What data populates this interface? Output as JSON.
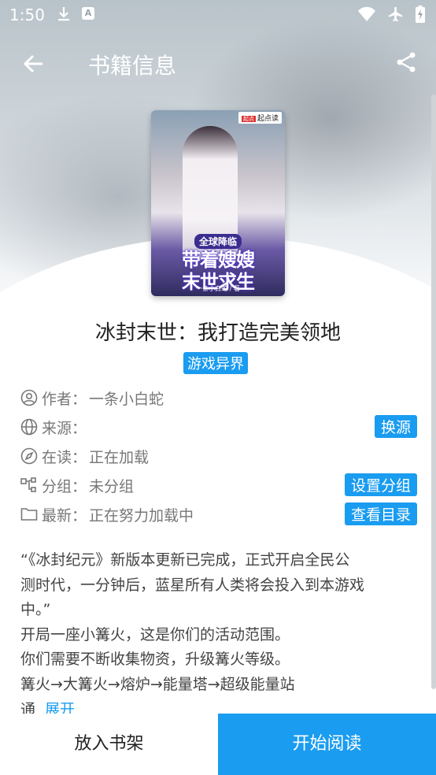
{
  "status_bar": {
    "time": "1:50",
    "icons": [
      "download-icon",
      "a-notification-icon",
      "wifi-icon",
      "airplane-icon",
      "battery-charging-icon"
    ]
  },
  "app_bar": {
    "title": "书籍信息",
    "back_icon": "arrow-left-icon",
    "share_icon": "share-icon"
  },
  "cover": {
    "badge_brand": "起点读",
    "badge_mark": "起点",
    "banner_top": "全球降临",
    "banner_line1": "带着嫂嫂",
    "banner_line2": "末世求生",
    "author_line": "一条小白蛇 / 著"
  },
  "book": {
    "title": "冰封末世：我打造完美领地",
    "tag": "游戏异界"
  },
  "info": {
    "author": {
      "key": "作者：",
      "value": "一条小白蛇"
    },
    "source": {
      "key": "来源：",
      "value": "",
      "button": "换源"
    },
    "reading": {
      "key": "在读：",
      "value": "正在加载"
    },
    "group": {
      "key": "分组：",
      "value": "未分组",
      "button": "设置分组"
    },
    "latest": {
      "key": "最新：",
      "value": "正在努力加载中",
      "button": "查看目录"
    }
  },
  "intro": {
    "line1": "“《冰封纪元》新版本更新已完成，正式开启全民公",
    "line2": "测时代，一分钟后，蓝星所有人类将会投入到本游戏",
    "line3": "中。”",
    "line4": "开局一座小篝火，这是你们的活动范围。",
    "line5": "你们需要不断收集物资，升级篝火等级。",
    "line6": "篝火→大篝火→熔炉→能量塔→超级能量站",
    "line7": "通",
    "expand": "展开"
  },
  "bottom_bar": {
    "add_shelf": "放入书架",
    "start_read": "开始阅读"
  },
  "colors": {
    "accent": "#1a9cf0",
    "text_primary": "#222222",
    "text_secondary": "#777777"
  }
}
